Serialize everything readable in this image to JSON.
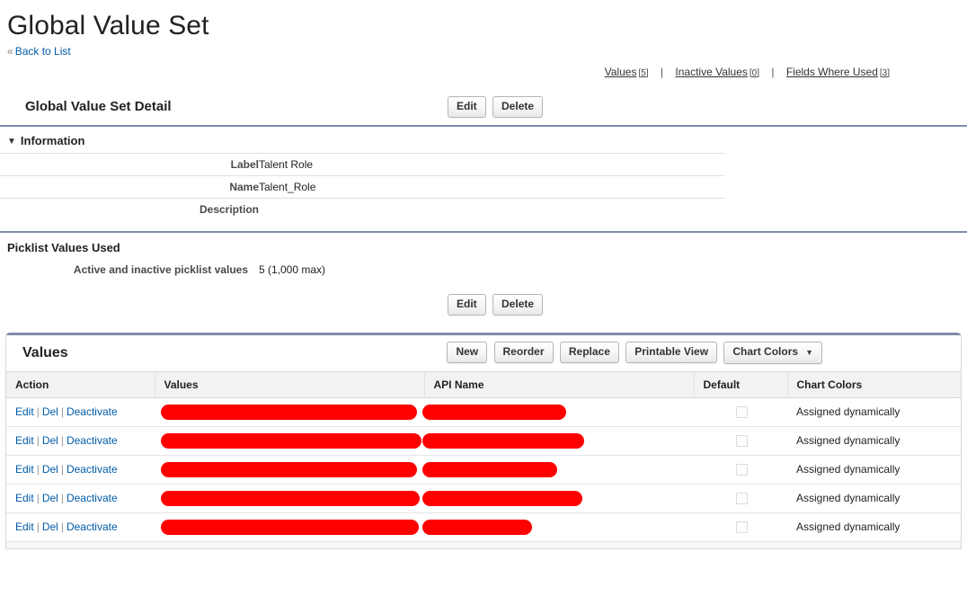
{
  "header": {
    "title": "Global Value Set",
    "back_link": "Back to List",
    "back_chevron": "«"
  },
  "related_links": [
    {
      "label": "Values",
      "count": "[5]"
    },
    {
      "label": "Inactive Values",
      "count": "[0]"
    },
    {
      "label": "Fields Where Used",
      "count": "[3]"
    }
  ],
  "separator": "|",
  "detail": {
    "section_title": "Global Value Set Detail",
    "edit_label": "Edit",
    "delete_label": "Delete"
  },
  "information": {
    "title": "Information",
    "twisty": "▼",
    "rows": [
      {
        "label": "Label",
        "value": "Talent Role"
      },
      {
        "label": "Name",
        "value": "Talent_Role"
      },
      {
        "label": "Description",
        "value": ""
      }
    ]
  },
  "picklist_values_used": {
    "title": "Picklist Values Used",
    "row_label": "Active and inactive picklist values",
    "row_value": "5 (1,000 max)",
    "edit_label": "Edit",
    "delete_label": "Delete"
  },
  "values_section": {
    "title": "Values",
    "buttons": [
      {
        "label": "New",
        "caret": ""
      },
      {
        "label": "Reorder",
        "caret": ""
      },
      {
        "label": "Replace",
        "caret": ""
      },
      {
        "label": "Printable View",
        "caret": ""
      },
      {
        "label": "Chart Colors",
        "caret": "▼"
      }
    ],
    "columns": [
      "Action",
      "Values",
      "API Name",
      "Default",
      "Chart Colors"
    ],
    "action_links": [
      "Edit",
      "Del",
      "Deactivate"
    ],
    "action_separator": "|",
    "rows": [
      {
        "values": "",
        "api_name": "",
        "default_checked": false,
        "chart_colors": "Assigned dynamically",
        "redact_values_width": 285,
        "redact_api_width": 160
      },
      {
        "values": "",
        "api_name": "",
        "default_checked": false,
        "chart_colors": "Assigned dynamically",
        "redact_values_width": 290,
        "redact_api_width": 180
      },
      {
        "values": "",
        "api_name": "",
        "default_checked": false,
        "chart_colors": "Assigned dynamically",
        "redact_values_width": 285,
        "redact_api_width": 150
      },
      {
        "values": "",
        "api_name": "",
        "default_checked": false,
        "chart_colors": "Assigned dynamically",
        "redact_values_width": 288,
        "redact_api_width": 178
      },
      {
        "values": "",
        "api_name": "",
        "default_checked": false,
        "chart_colors": "Assigned dynamically",
        "redact_values_width": 287,
        "redact_api_width": 122
      }
    ]
  },
  "colors": {
    "link": "#015ba7",
    "section_rule": "#7f8daa",
    "redaction": "#fe0000",
    "header_bg": "#f2f2f2"
  }
}
